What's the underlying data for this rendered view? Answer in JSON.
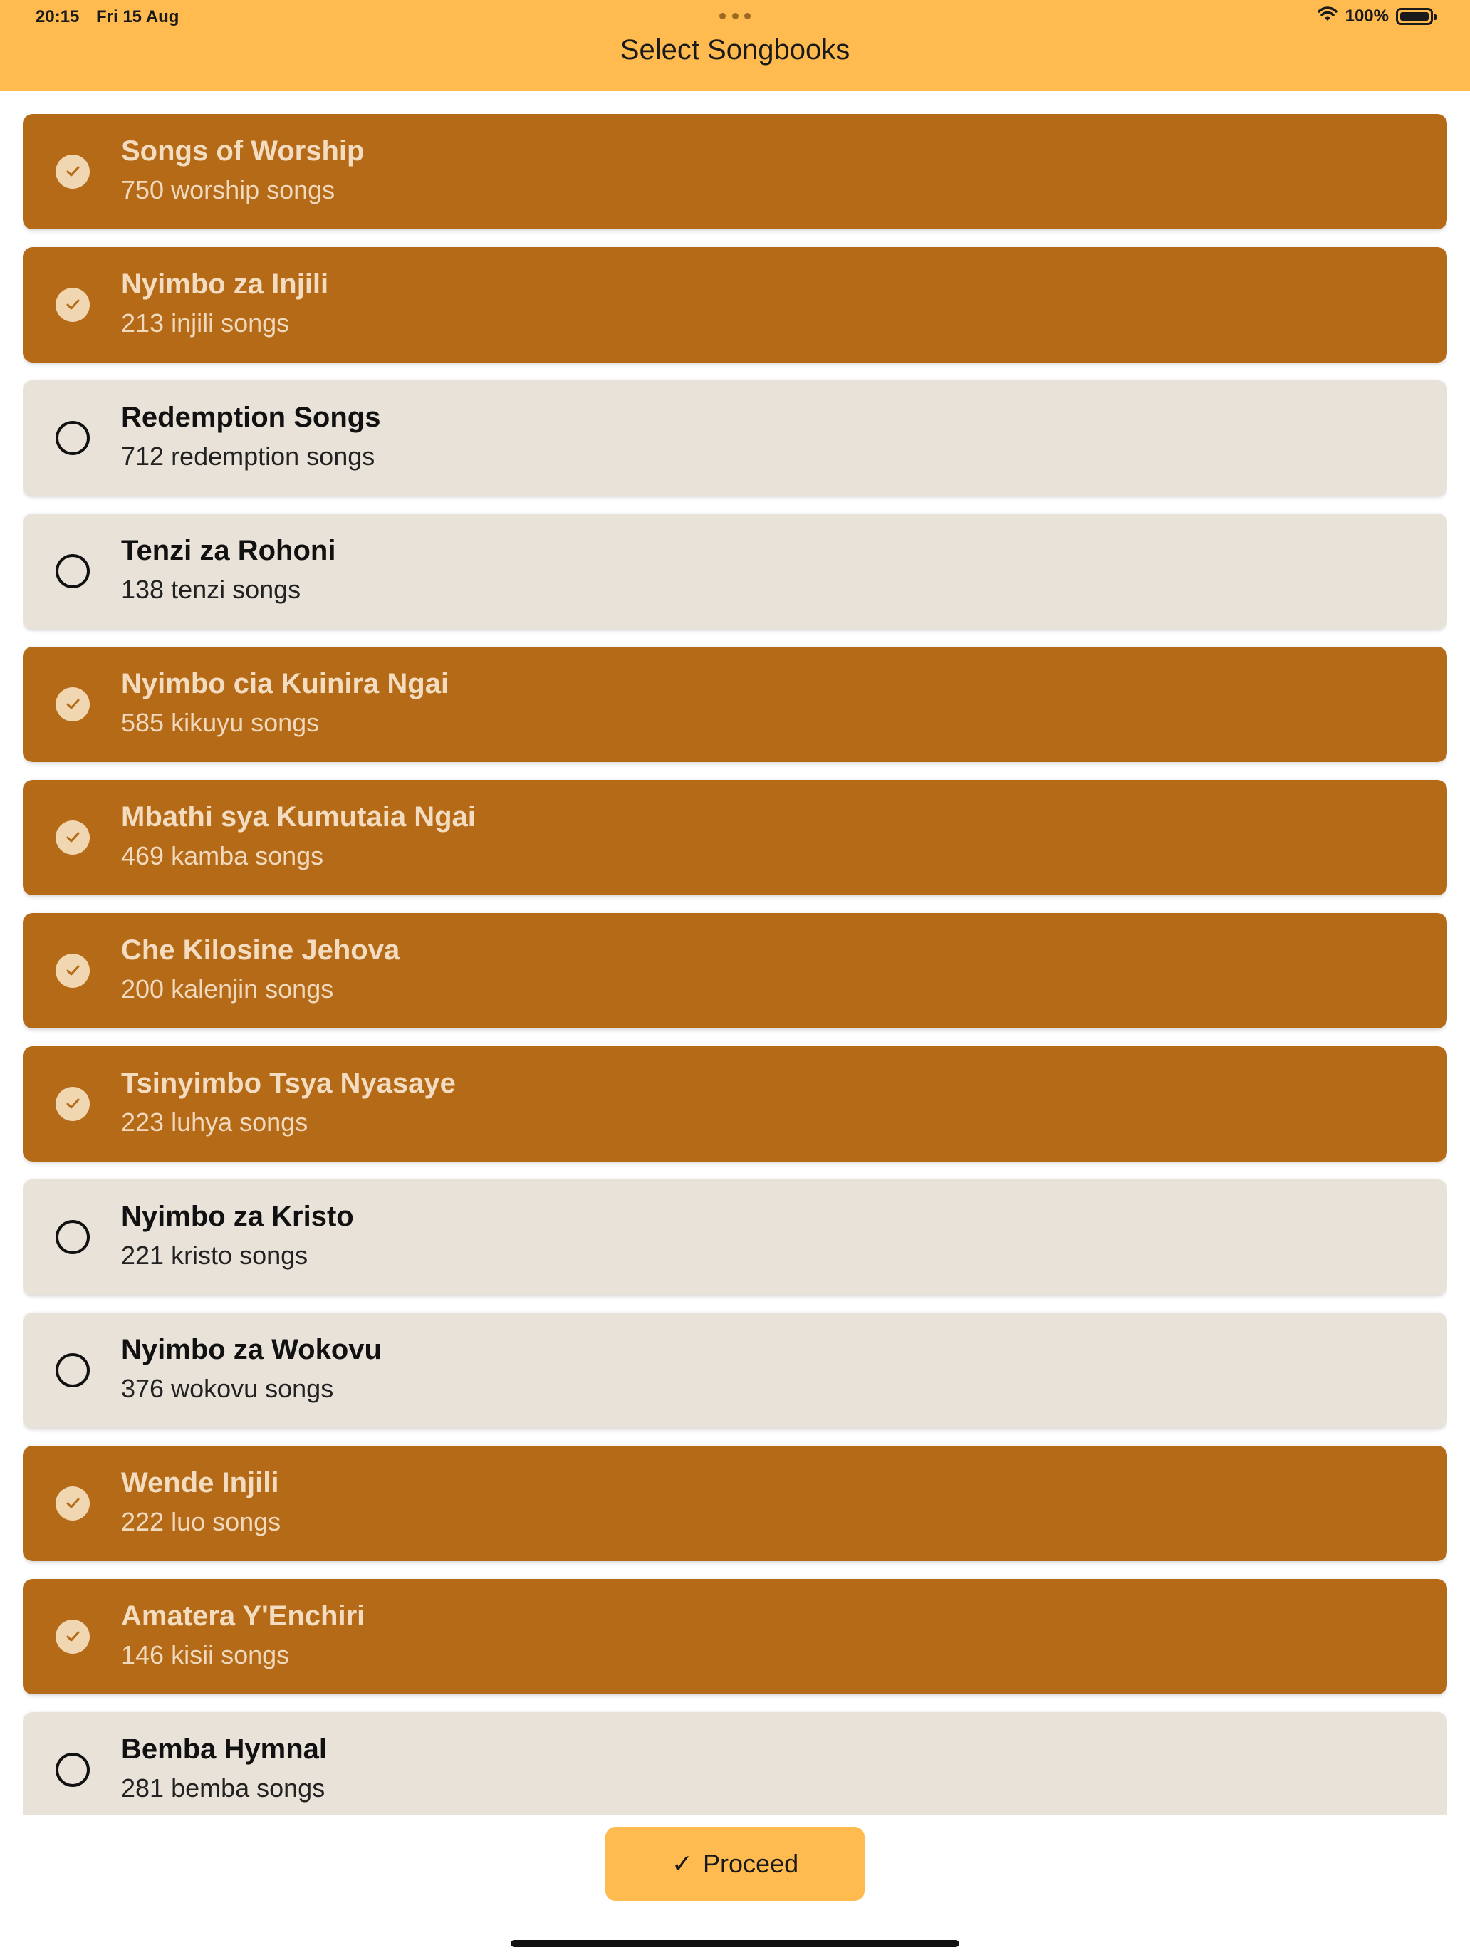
{
  "status_bar": {
    "time": "20:15",
    "date": "Fri 15 Aug",
    "battery": "100%"
  },
  "header": {
    "title": "Select Songbooks"
  },
  "colors": {
    "header": "#ffbb4f",
    "selected_card": "#b56a17",
    "unselected_card": "#e8e2d9",
    "button": "#ffbb4f"
  },
  "songbooks": [
    {
      "title": "Songs of Worship",
      "subtitle": "750 worship songs",
      "selected": true
    },
    {
      "title": "Nyimbo za Injili",
      "subtitle": "213 injili songs",
      "selected": true
    },
    {
      "title": "Redemption Songs",
      "subtitle": "712 redemption songs",
      "selected": false
    },
    {
      "title": "Tenzi za Rohoni",
      "subtitle": "138 tenzi songs",
      "selected": false
    },
    {
      "title": "Nyimbo cia Kuinira Ngai",
      "subtitle": "585 kikuyu songs",
      "selected": true
    },
    {
      "title": "Mbathi sya Kumutaia Ngai",
      "subtitle": "469 kamba songs",
      "selected": true
    },
    {
      "title": "Che Kilosine Jehova",
      "subtitle": "200 kalenjin songs",
      "selected": true
    },
    {
      "title": "Tsinyimbo Tsya Nyasaye",
      "subtitle": "223 luhya songs",
      "selected": true
    },
    {
      "title": "Nyimbo za Kristo",
      "subtitle": "221 kristo songs",
      "selected": false
    },
    {
      "title": "Nyimbo za Wokovu",
      "subtitle": "376 wokovu songs",
      "selected": false
    },
    {
      "title": "Wende Injili",
      "subtitle": "222 luo songs",
      "selected": true
    },
    {
      "title": "Amatera Y'Enchiri",
      "subtitle": "146 kisii songs",
      "selected": true
    },
    {
      "title": "Bemba Hymnal",
      "subtitle": "281 bemba songs",
      "selected": false
    }
  ],
  "footer": {
    "proceed_icon": "✓",
    "proceed_label": "Proceed"
  }
}
